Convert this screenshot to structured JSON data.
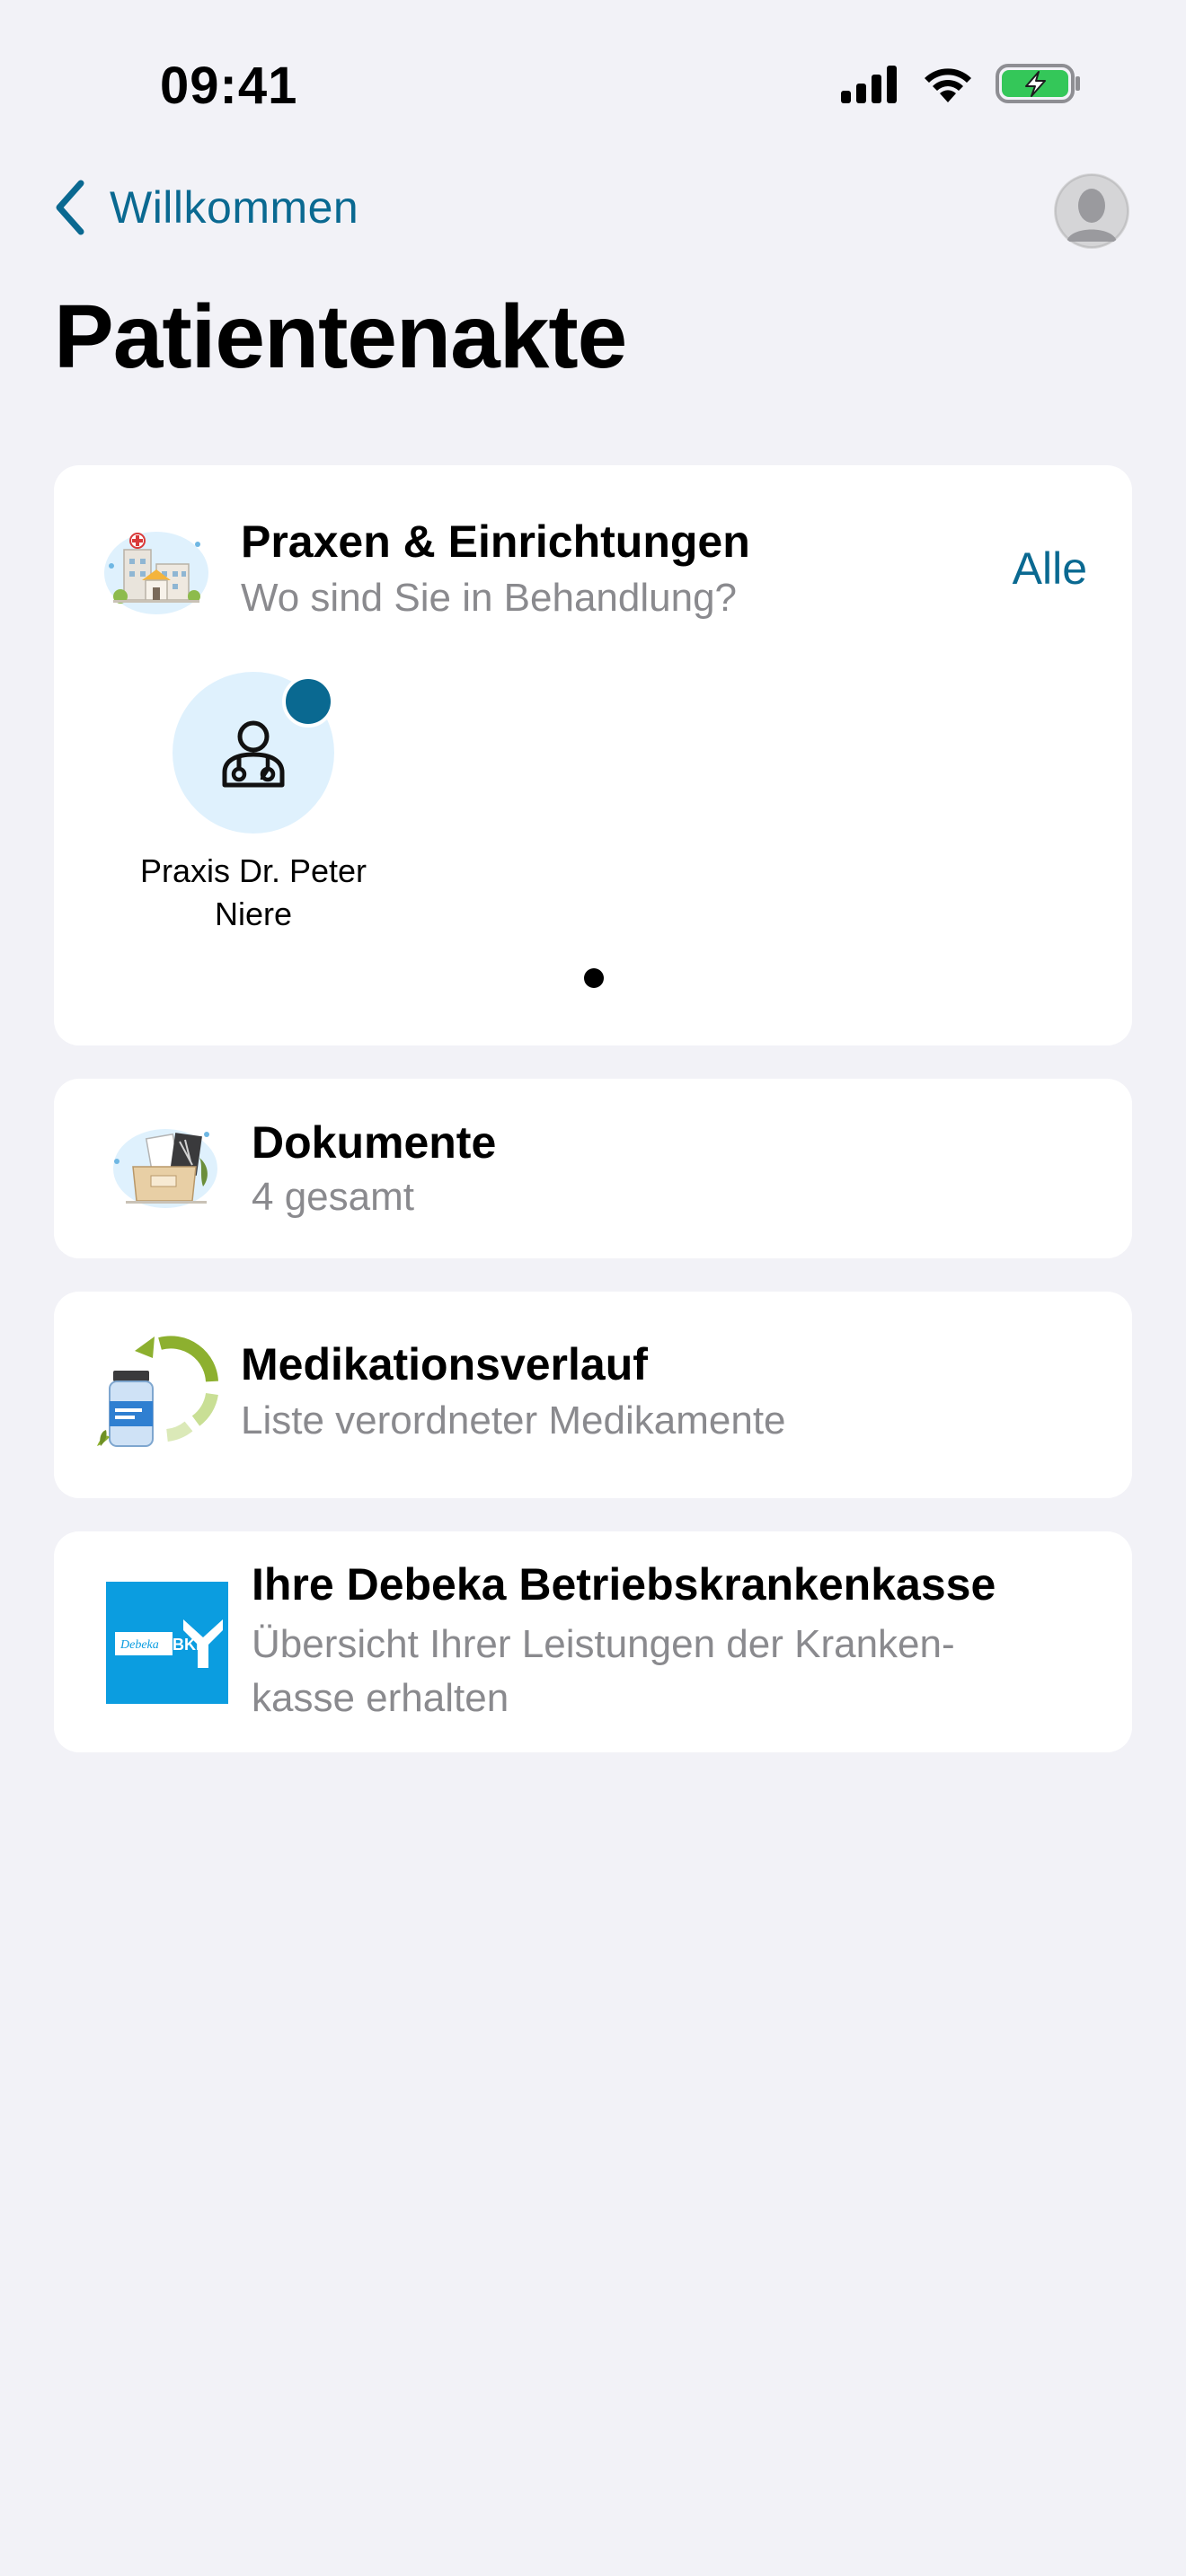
{
  "status_bar": {
    "time": "09:41"
  },
  "nav": {
    "back_label": "Willkommen"
  },
  "page": {
    "title": "Patientenakte"
  },
  "praxen": {
    "title": "Praxen & Einrichtungen",
    "subtitle": "Wo sind Sie in Behandlung?",
    "all_label": "Alle",
    "practices": [
      {
        "name": "Praxis Dr. Peter Niere",
        "has_badge": true
      }
    ]
  },
  "dokumente": {
    "title": "Dokumente",
    "subtitle": "4 gesamt"
  },
  "medikation": {
    "title": "Medikationsverlauf",
    "subtitle": "Liste verordneter Medikamente"
  },
  "kasse": {
    "title": "Ihre Debeka Betriebskrankenkasse",
    "subtitle_line1": "Übersicht Ihrer Leistungen der Kranken-",
    "subtitle_line2": "kasse erhalten",
    "logo_text_brand": "Debeka",
    "logo_text_bkk": "BKK"
  },
  "colors": {
    "accent": "#0a6991",
    "background": "#f2f2f7",
    "card": "#ffffff",
    "secondary_text": "#8a8a8e",
    "battery_green": "#34c759",
    "kasse_blue": "#0b9de0"
  },
  "icons": {
    "back": "chevron-left-icon",
    "avatar": "person-icon",
    "praxen": "hospital-illustration-icon",
    "practice": "doctor-icon",
    "dokumente": "document-box-illustration-icon",
    "medikation": "medication-cycle-icon",
    "kasse": "debeka-bkk-logo"
  }
}
